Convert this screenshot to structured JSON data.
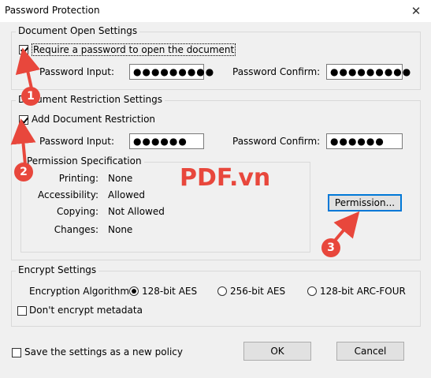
{
  "window": {
    "title": "Password Protection",
    "close": "✕"
  },
  "open_settings": {
    "legend": "Document Open Settings",
    "require_label": "Require a password to open the document",
    "require_checked": true,
    "password_input_label": "Password Input:",
    "password_input_value": "●●●●●●●●●",
    "password_confirm_label": "Password Confirm:",
    "password_confirm_value": "●●●●●●●●●"
  },
  "restriction_settings": {
    "legend": "Document Restriction Settings",
    "add_label": "Add Document Restriction",
    "add_checked": true,
    "password_input_label": "Password Input:",
    "password_input_value": "●●●●●●",
    "password_confirm_label": "Password Confirm:",
    "password_confirm_value": "●●●●●●",
    "permission_spec": {
      "legend": "Permission Specification",
      "rows": [
        {
          "label": "Printing:",
          "value": "None"
        },
        {
          "label": "Accessibility:",
          "value": "Allowed"
        },
        {
          "label": "Copying:",
          "value": "Not Allowed"
        },
        {
          "label": "Changes:",
          "value": "None"
        }
      ]
    },
    "permission_button": "Permission..."
  },
  "encrypt_settings": {
    "legend": "Encrypt Settings",
    "algorithm_label": "Encryption Algorithm:",
    "options": [
      {
        "label": "128-bit AES",
        "checked": true
      },
      {
        "label": "256-bit AES",
        "checked": false
      },
      {
        "label": "128-bit ARC-FOUR",
        "checked": false
      }
    ],
    "dont_encrypt_metadata": "Don't encrypt metadata"
  },
  "footer": {
    "save_policy": "Save the settings as a new policy",
    "ok": "OK",
    "cancel": "Cancel"
  },
  "annotations": {
    "watermark": "PDF.vn",
    "badges": [
      "1",
      "2",
      "3"
    ],
    "accent_color": "#e8473c"
  }
}
